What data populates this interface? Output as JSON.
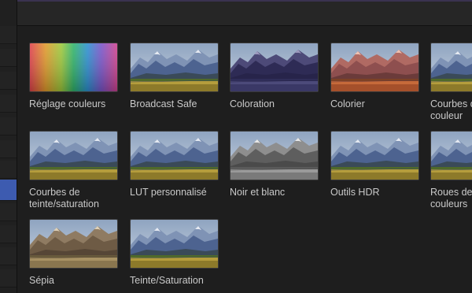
{
  "effects": [
    {
      "name": "Réglage couleurs",
      "style": "rainbow"
    },
    {
      "name": "Broadcast Safe",
      "style": "normal"
    },
    {
      "name": "Coloration",
      "style": "purple"
    },
    {
      "name": "Colorier",
      "style": "red"
    },
    {
      "name": "Courbes de\ncouleur",
      "style": "normal"
    },
    {
      "name": "Courbes de\nteinte/saturation",
      "style": "normal"
    },
    {
      "name": "LUT personnalisé",
      "style": "normal"
    },
    {
      "name": "Noir et blanc",
      "style": "bw"
    },
    {
      "name": "Outils HDR",
      "style": "normal"
    },
    {
      "name": "Roues de\ncouleurs",
      "style": "normal"
    },
    {
      "name": "Sépia",
      "style": "sepia"
    },
    {
      "name": "Teinte/Saturation",
      "style": "normal"
    }
  ]
}
